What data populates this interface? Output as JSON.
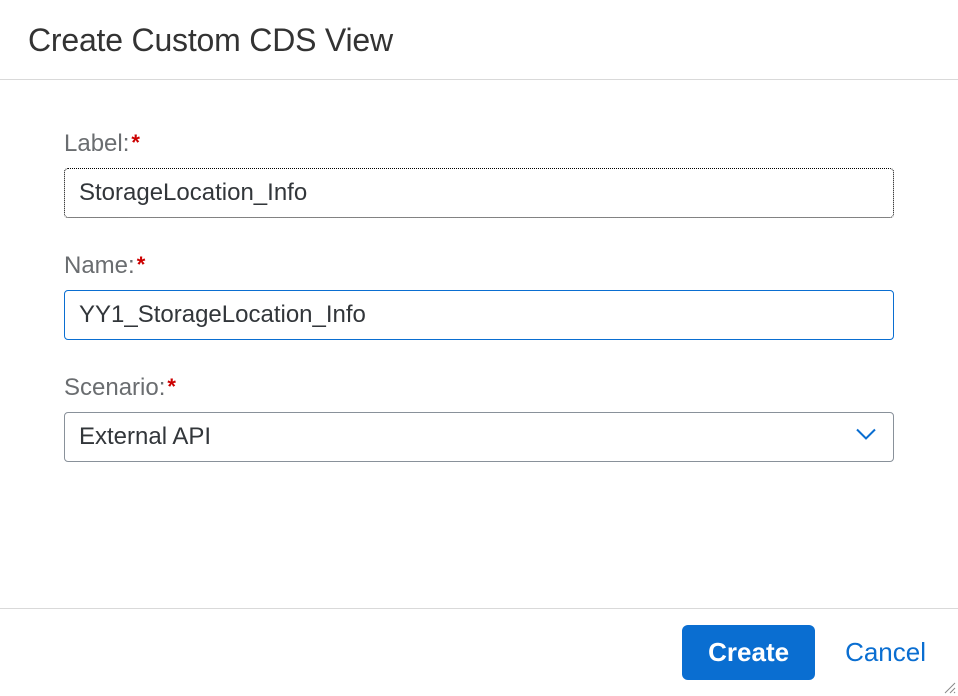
{
  "header": {
    "title": "Create Custom CDS View"
  },
  "form": {
    "label_field": {
      "label": "Label:",
      "value": "StorageLocation_Info",
      "required": true
    },
    "name_field": {
      "label": "Name:",
      "value": "YY1_StorageLocation_Info",
      "required": true
    },
    "scenario_field": {
      "label": "Scenario:",
      "value": "External API",
      "required": true
    }
  },
  "footer": {
    "create_label": "Create",
    "cancel_label": "Cancel"
  }
}
